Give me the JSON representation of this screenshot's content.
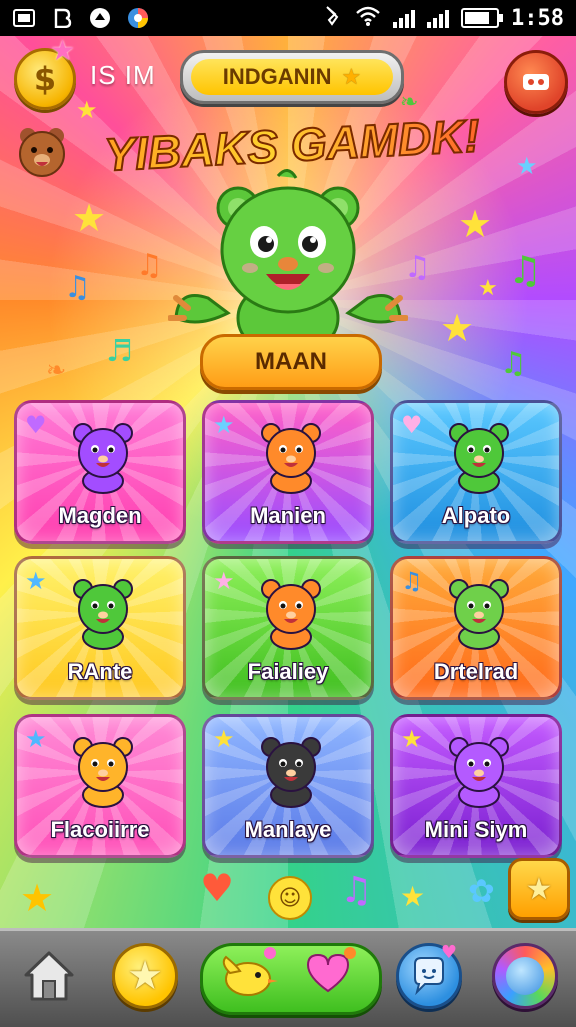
{
  "status_bar": {
    "left_icons": [
      "screen-mirror-icon",
      "b-icon",
      "app-icon",
      "browser-icon"
    ],
    "right_icons": [
      "vibrate-icon",
      "wifi-icon",
      "signal-icon",
      "signal-icon",
      "battery-icon"
    ],
    "time": "1:58",
    "battery_level": 0.85
  },
  "header": {
    "coin_symbol": "$",
    "label": "IS IM",
    "banner": "INDGANIN"
  },
  "title": "YIBAKS GAMDK!",
  "main_button": "MAAN",
  "cards": [
    {
      "label": "Magden",
      "color_top": "#ff7ad6",
      "color_bottom": "#ff3fb0",
      "creature_color": "#a34dff"
    },
    {
      "label": "Manien",
      "color_top": "#ff5fc8",
      "color_bottom": "#9a4dff",
      "creature_color": "#ff8a2a"
    },
    {
      "label": "Alpato",
      "color_top": "#5ac8ff",
      "color_bottom": "#1f8fe0",
      "creature_color": "#4fc83a"
    },
    {
      "label": "RAnte",
      "color_top": "#fff26a",
      "color_bottom": "#ffc81f",
      "creature_color": "#4fc83a"
    },
    {
      "label": "Faialiey",
      "color_top": "#8ef05a",
      "color_bottom": "#3fbf1f",
      "creature_color": "#ff8a2a"
    },
    {
      "label": "Drtelrad",
      "color_top": "#ffaa3a",
      "color_bottom": "#ff6a1a",
      "creature_color": "#6fd04a"
    },
    {
      "label": "Flacoiirre",
      "color_top": "#ff8ad6",
      "color_bottom": "#ff4fb8",
      "creature_color": "#ffb42a"
    },
    {
      "label": "Manlaye",
      "color_top": "#8fb6ff",
      "color_bottom": "#5a7ae8",
      "creature_color": "#3a3a3a"
    },
    {
      "label": "Mini Siym",
      "color_top": "#c45aff",
      "color_bottom": "#7a1fd0",
      "creature_color": "#b45aff"
    }
  ],
  "bottom_nav": {
    "items": [
      "home-icon",
      "star-icon",
      "bird-heart-icon",
      "chat-icon",
      "globe-icon"
    ]
  },
  "colors": {
    "accent_yellow": "#ffc400",
    "hero_green": "#5cc83a",
    "nav_bg": "#5f5f5f"
  }
}
